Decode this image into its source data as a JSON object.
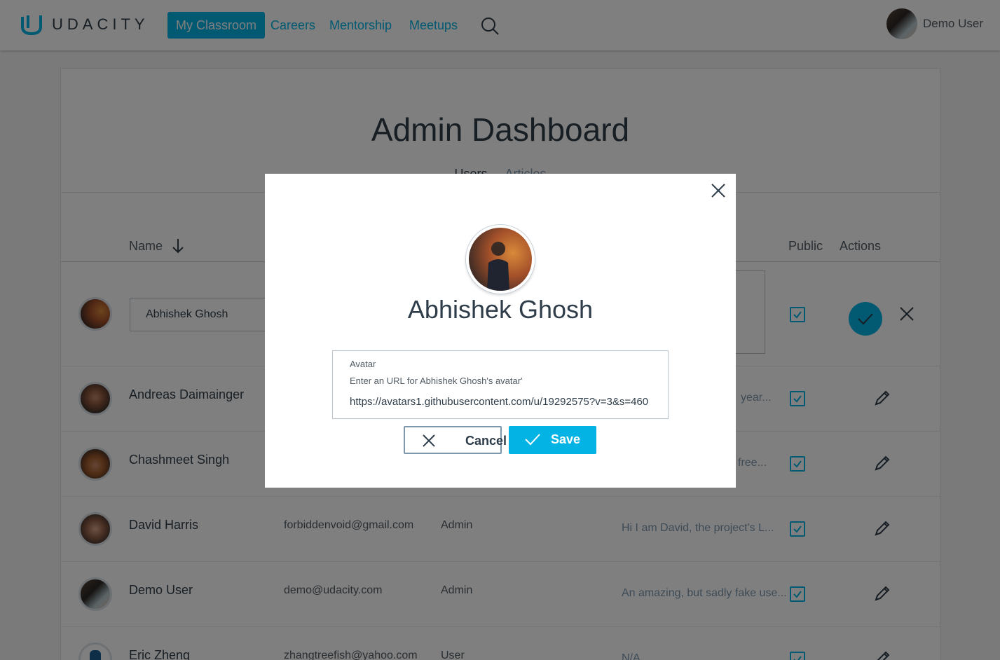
{
  "nav": {
    "logo_text": "UDACITY",
    "items": [
      {
        "label": "My Classroom",
        "active": true
      },
      {
        "label": "Careers"
      },
      {
        "label": "Mentorship"
      },
      {
        "label": "Meetups"
      }
    ],
    "user_name": "Demo User"
  },
  "dashboard": {
    "title": "Admin Dashboard",
    "tabs": [
      {
        "label": "Users",
        "active": true
      },
      {
        "label": "Articles"
      }
    ],
    "columns": {
      "name": "Name",
      "public": "Public",
      "actions": "Actions"
    }
  },
  "editing_row": {
    "name_value": "Abhishek Ghosh"
  },
  "rows": [
    {
      "name": "Andreas Daimainger",
      "email": "",
      "role": "",
      "bio": "year...",
      "public": true
    },
    {
      "name": "Chashmeet Singh",
      "email": "",
      "role": "",
      "bio": "free...",
      "public": true
    },
    {
      "name": "David Harris",
      "email": "forbiddenvoid@gmail.com",
      "role": "Admin",
      "bio": "Hi I am David, the project's L...",
      "public": true
    },
    {
      "name": "Demo User",
      "email": "demo@udacity.com",
      "role": "Admin",
      "bio": "An amazing, but sadly fake use...",
      "public": true
    },
    {
      "name": "Eric Zheng",
      "email": "zhangtreefish@yahoo.com",
      "role": "User",
      "bio": "N/A",
      "public": true
    }
  ],
  "modal": {
    "user_name": "Abhishek Ghosh",
    "field_label": "Avatar",
    "field_hint": "Enter an URL for Abhishek Ghosh's avatar'",
    "field_value": "https://avatars1.githubusercontent.com/u/19292575?v=3&s=460",
    "cancel_label": "Cancel",
    "save_label": "Save"
  },
  "colors": {
    "accent": "#02b3e4",
    "text": "#2e3d49",
    "overlay": "rgba(0,0,0,0.5)"
  }
}
